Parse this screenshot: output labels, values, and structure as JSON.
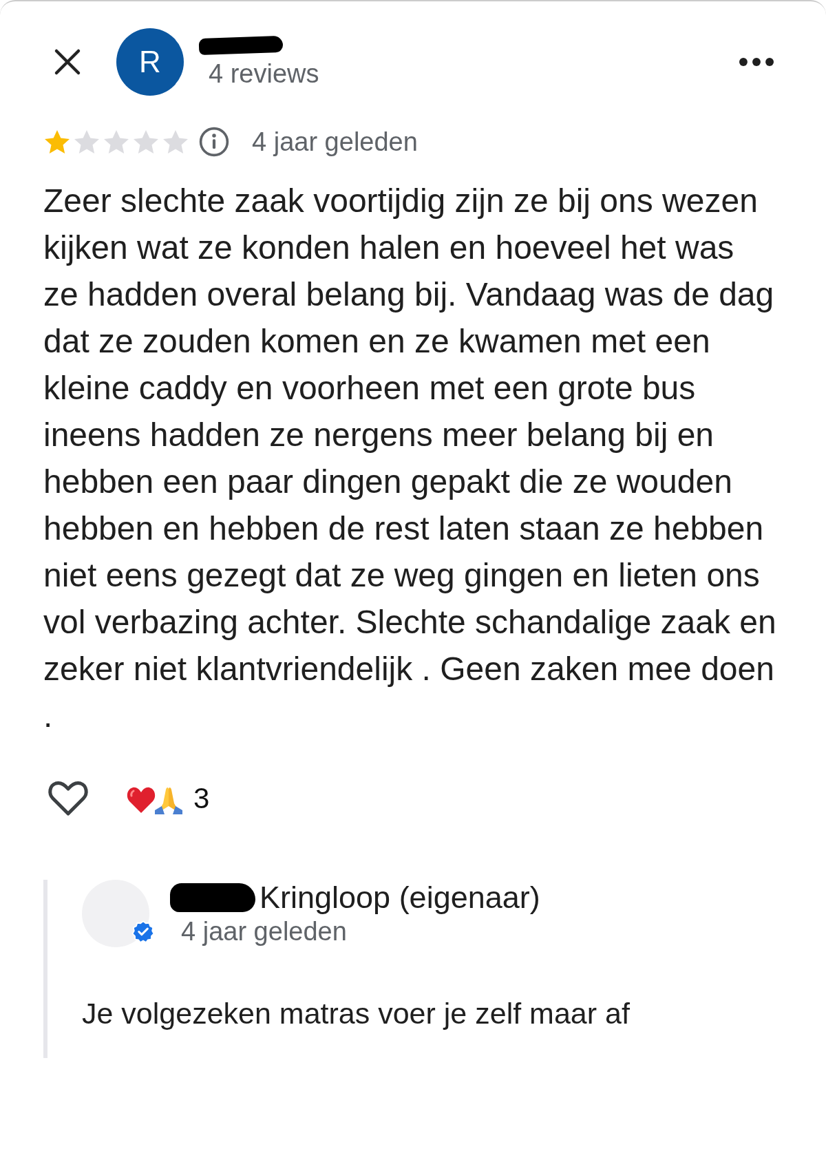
{
  "reviewer": {
    "avatar_letter": "R",
    "review_count": "4 reviews"
  },
  "review": {
    "stars": 1,
    "time": "4 jaar geleden",
    "text": "Zeer slechte zaak voortijdig zijn ze bij ons wezen kijken wat ze konden halen en hoeveel het was  ze hadden overal belang bij. Vandaag was de dag dat ze zouden komen en ze kwamen met een kleine caddy en voorheen met een grote bus ineens hadden ze nergens meer belang bij en hebben een paar dingen gepakt die ze wouden hebben en hebben de rest laten staan ze hebben niet eens gezegt dat ze weg gingen en lieten ons vol verbazing achter. Slechte schandalige zaak en zeker niet klantvriendelijk . Geen zaken mee doen .",
    "reaction_count": "3"
  },
  "owner_reply": {
    "name": "Kringloop (eigenaar)",
    "verified": true,
    "time": "4 jaar geleden",
    "text": "Je volgezeken matras voer je zelf maar af"
  }
}
